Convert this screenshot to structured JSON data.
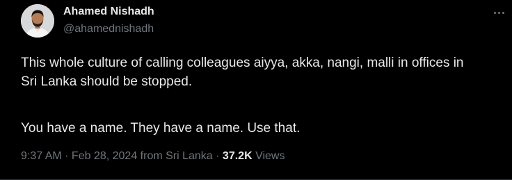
{
  "author": {
    "name": "Ahamed Nishadh",
    "handle": "@ahamednishadh",
    "avatar": "profile-photo"
  },
  "more_icon": "more-horizontal-icon",
  "tweet": {
    "line_1": "This whole culture of calling colleagues aiyya, akka, nangi, malli in offices in",
    "line_2": "Sri Lanka should be stopped.",
    "line_3": "You have a name. They have a name. Use that."
  },
  "meta": {
    "time": "9:37 AM",
    "separator_1": " · ",
    "date": "Feb 28, 2024",
    "location": " from Sri Lanka",
    "separator_2": " · ",
    "views_count": "37.2K",
    "views_label": " Views"
  },
  "colors": {
    "background": "#000000",
    "text_primary": "#e7e9ea",
    "text_secondary": "#71767b",
    "divider": "#2f3336"
  }
}
